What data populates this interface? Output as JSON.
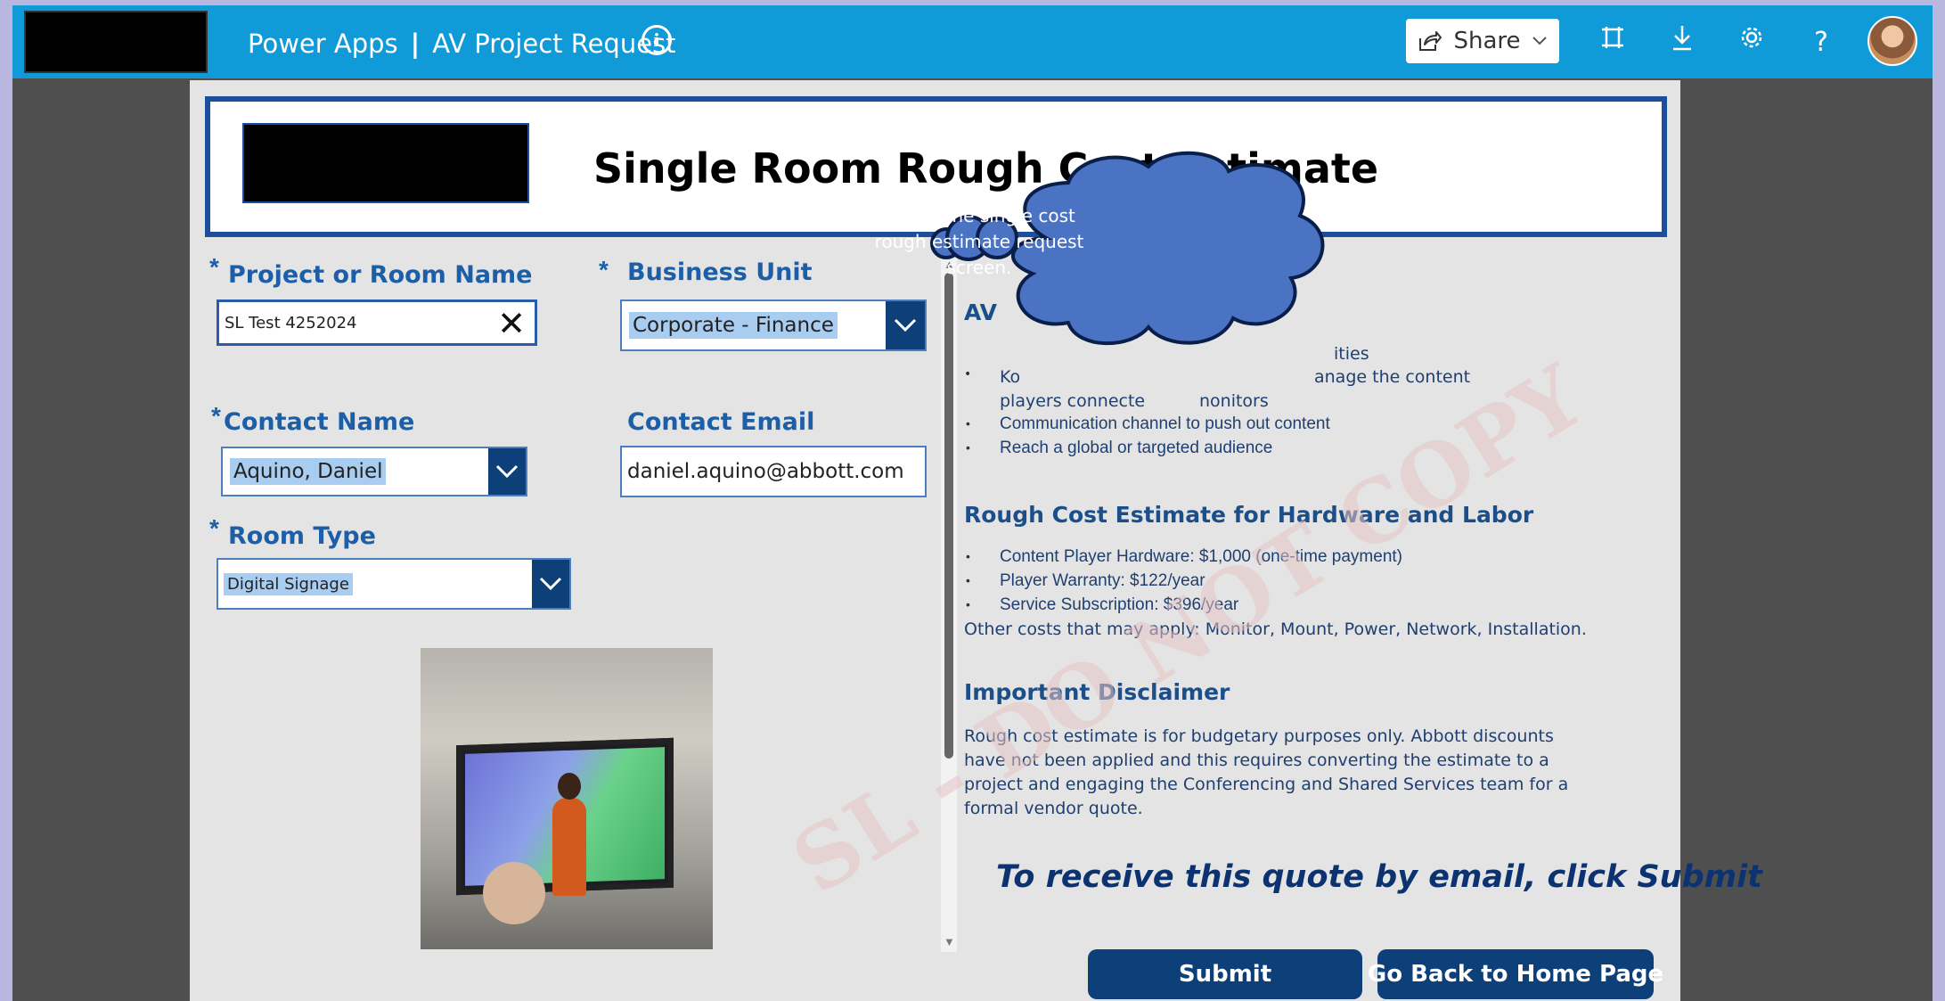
{
  "app": {
    "product": "Power Apps",
    "separator": "|",
    "app_name": "AV Project Request",
    "info_icon": "i",
    "share_label": "Share",
    "help_glyph": "?"
  },
  "header": {
    "title": "Single Room Rough Cost Estimate"
  },
  "form": {
    "project_label": "Project or Room Name",
    "project_value": "SL Test 4252024",
    "business_unit_label": "Business Unit",
    "business_unit_value": "Corporate - Finance",
    "contact_name_label": "Contact Name",
    "contact_name_value": "Aquino, Daniel",
    "contact_email_label": "Contact Email",
    "contact_email_value": "daniel.aquino@abbott.com",
    "room_type_label": "Room Type",
    "room_type_value": "Digital Signage",
    "required_mark": "*"
  },
  "right_panel": {
    "top_heading_fragment": "AV",
    "top_bullets": [
      "ities",
      "Ko",
      "anage the content",
      "players connecte",
      "nonitors"
    ],
    "bullets_full": [
      "Communication channel to push out content",
      "Reach a global or targeted audience"
    ],
    "cost_heading": "Rough Cost Estimate for Hardware and Labor",
    "cost_bullets": [
      "Content Player Hardware: $1,000 (one-time payment)",
      "Player Warranty: $122/year",
      "Service Subscription: $396/year"
    ],
    "other_costs": "Other costs that may apply: Monitor, Mount, Power, Network, Installation.",
    "disclaimer_heading": "Important Disclaimer",
    "disclaimer_text": "Rough cost estimate is for budgetary purposes only. Abbott discounts have not been applied and this requires converting the estimate to a project and engaging the Conferencing and Shared Services team for a formal vendor quote.",
    "cta": "To receive this quote by email, click Submit"
  },
  "watermark": "SL - DO NOT COPY",
  "callout": {
    "text": "This is the single cost rough estimate request screen."
  },
  "buttons": {
    "submit": "Submit",
    "home": "Go Back to Home Page"
  },
  "colors": {
    "topbar": "#119ad8",
    "brand_dark": "#0d3f79",
    "label_blue": "#1c5fa8",
    "callout_fill": "#4a73c4"
  }
}
